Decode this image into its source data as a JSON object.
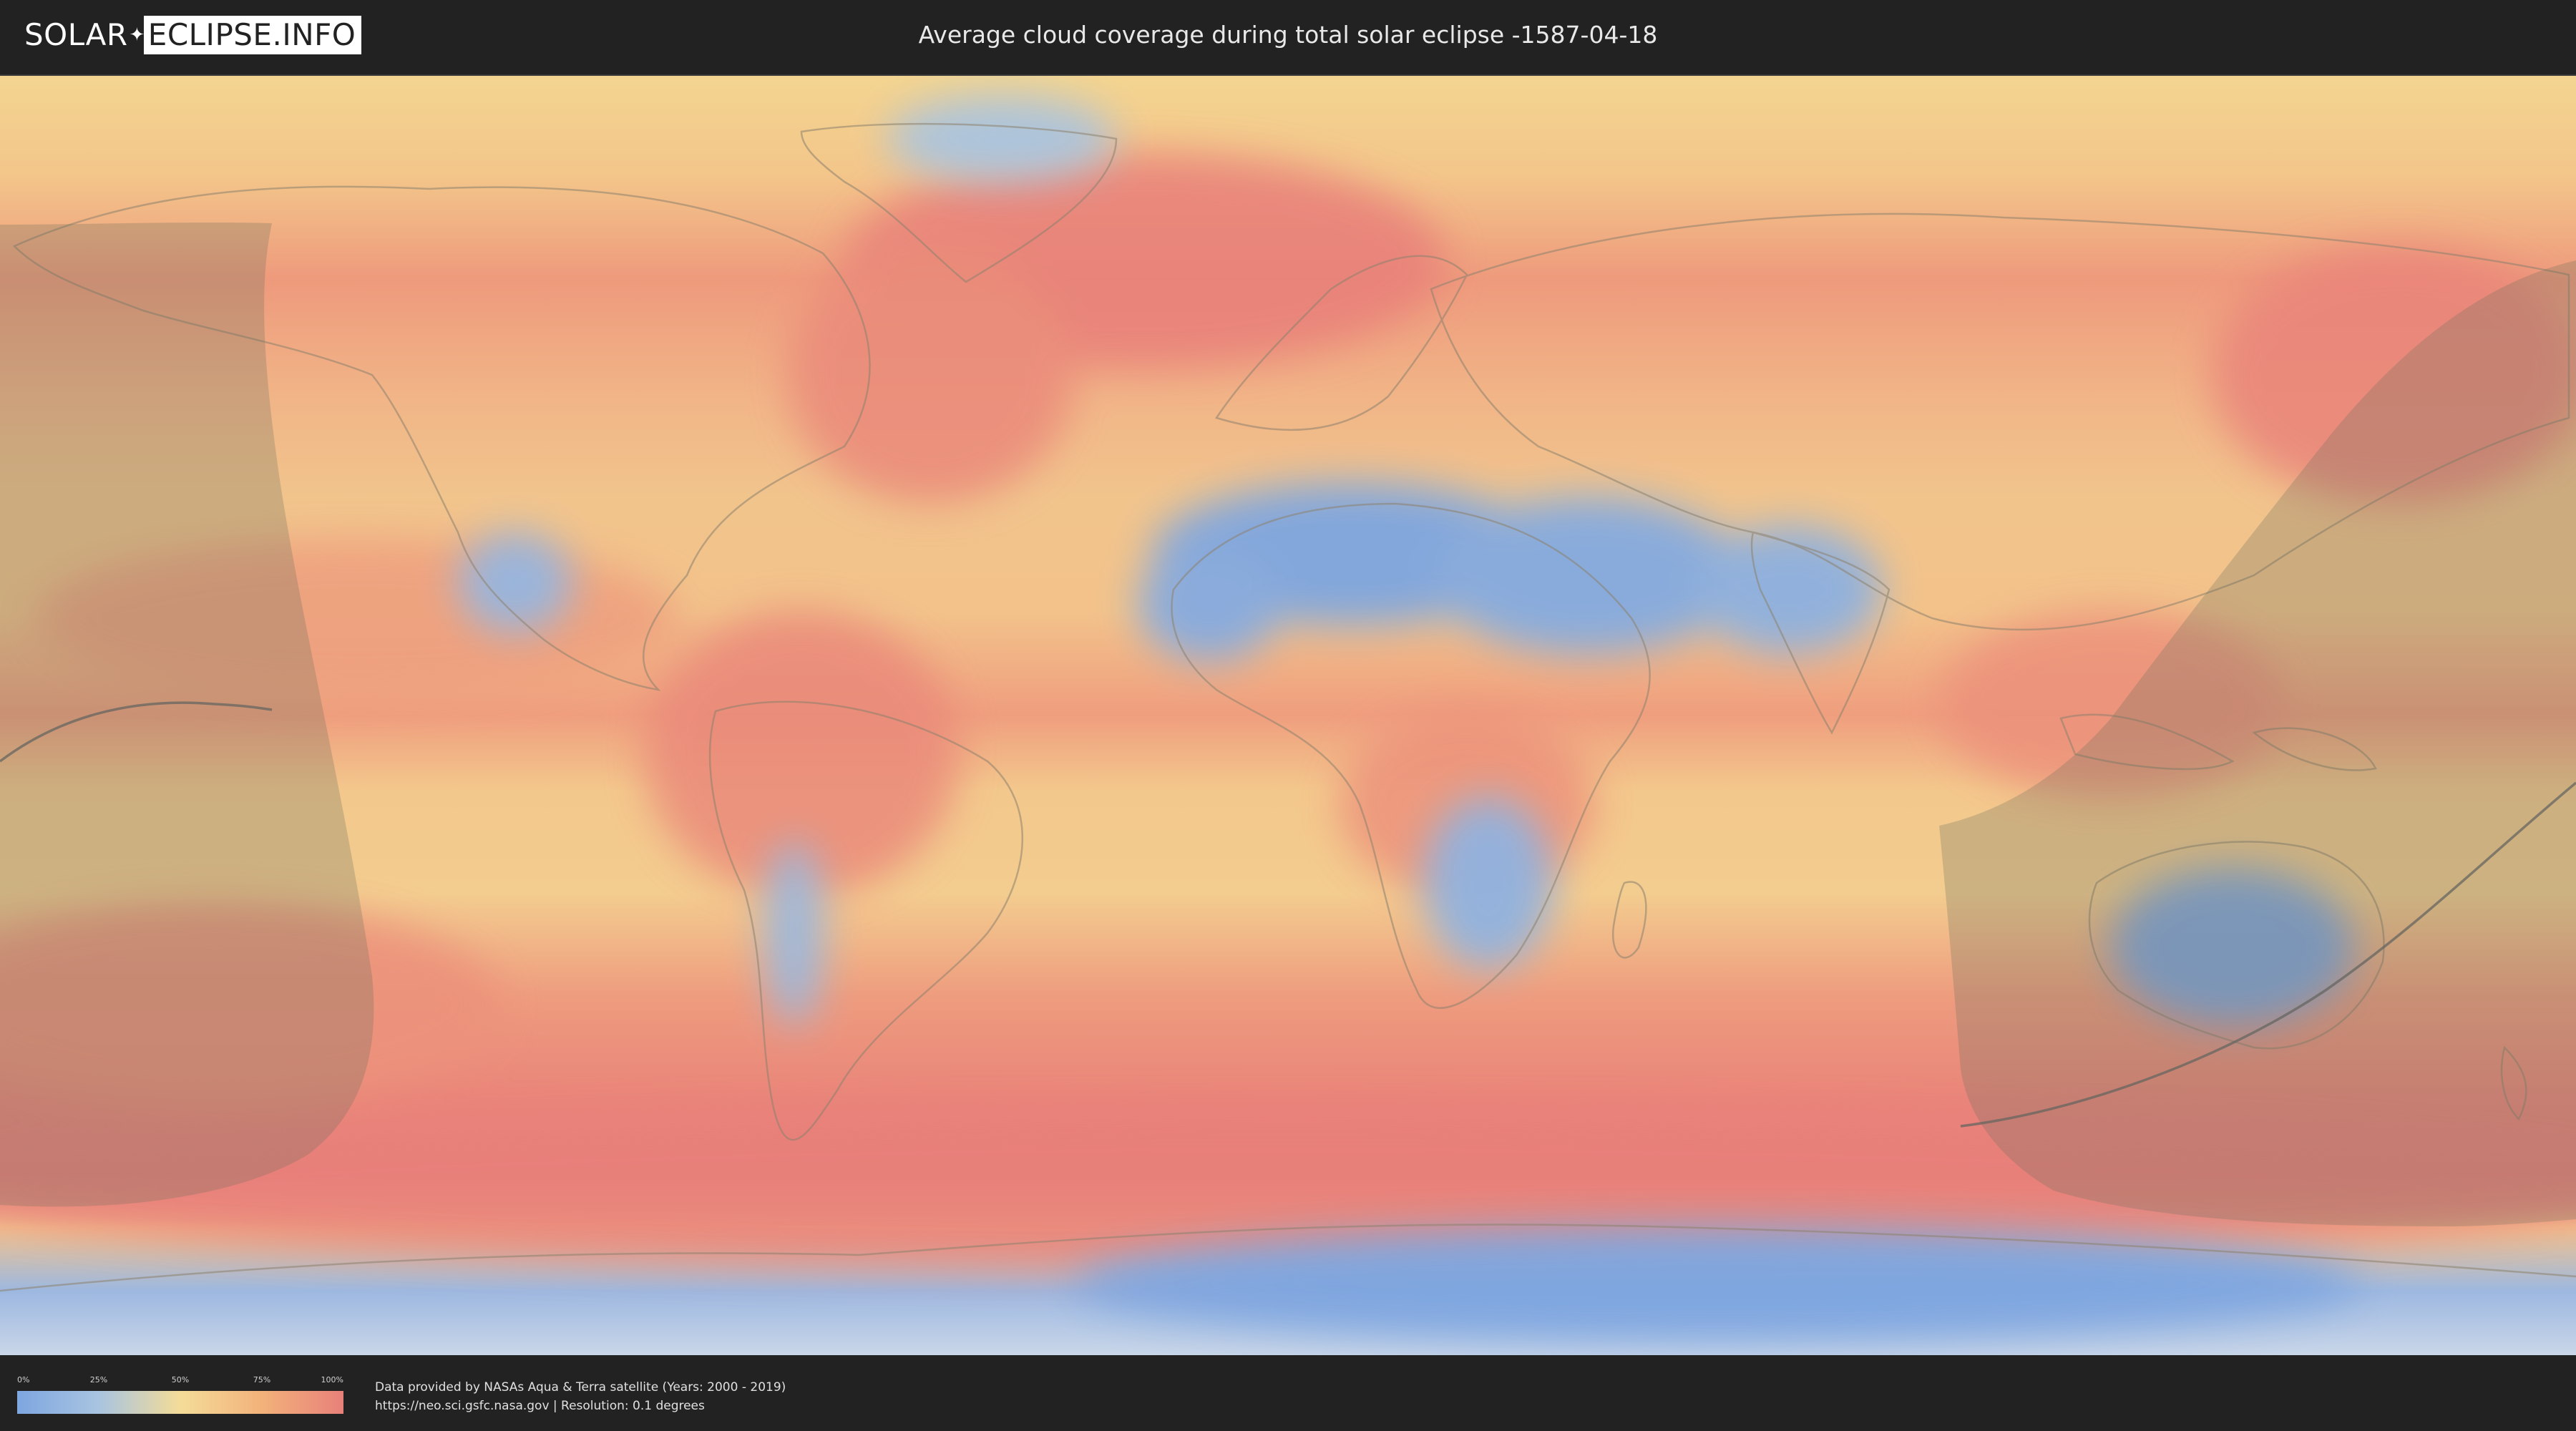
{
  "header": {
    "logo_left": "SOLAR",
    "logo_right": "ECLIPSE.INFO",
    "title": "Average cloud coverage during total solar eclipse -1587-04-18"
  },
  "legend": {
    "ticks": [
      "0%",
      "25%",
      "50%",
      "75%",
      "100%"
    ],
    "colors": [
      "#7ea6e0",
      "#a8c4e0",
      "#f4dc98",
      "#f2b27a",
      "#e8807a"
    ]
  },
  "footer": {
    "source_line": "Data provided by NASAs Aqua & Terra satellite (Years: 2000 - 2019)",
    "url_line": "https://neo.sci.gsfc.nasa.gov | Resolution: 0.1 degrees"
  },
  "icons": {
    "logo_spark": "star-burst-icon"
  }
}
